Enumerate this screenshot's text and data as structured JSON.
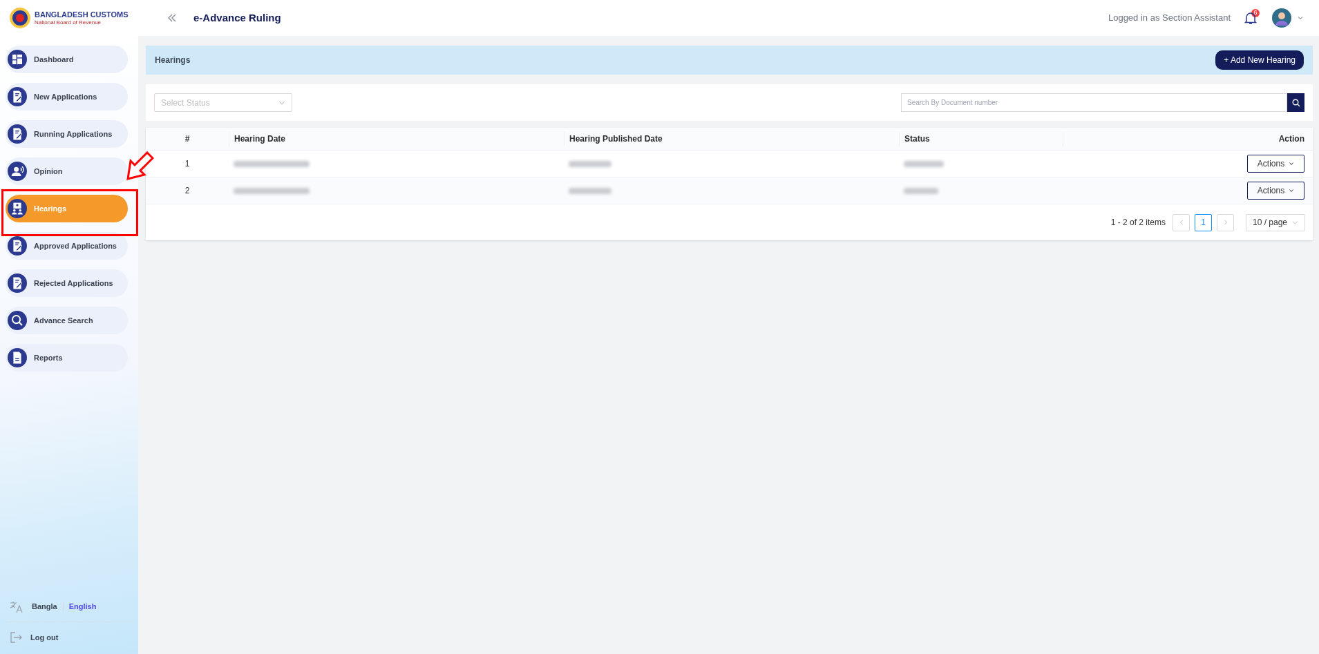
{
  "header": {
    "logo_title": "BANGLADESH CUSTOMS",
    "logo_subtitle": "National Board of Revenue",
    "app_title": "e-Advance Ruling",
    "user_label": "Logged in as Section Assistant",
    "notification_count": "6"
  },
  "sidebar": {
    "items": [
      {
        "label": "Dashboard",
        "kind": "dashboard",
        "selected": false
      },
      {
        "label": "New Applications",
        "kind": "document",
        "selected": false
      },
      {
        "label": "Running Applications",
        "kind": "document",
        "selected": false
      },
      {
        "label": "Opinion",
        "kind": "opinion",
        "selected": false
      },
      {
        "label": "Hearings",
        "kind": "hearing",
        "selected": true
      },
      {
        "label": "Approved Applications",
        "kind": "document",
        "selected": false
      },
      {
        "label": "Rejected Applications",
        "kind": "document",
        "selected": false
      },
      {
        "label": "Advance Search",
        "kind": "search",
        "selected": false
      },
      {
        "label": "Reports",
        "kind": "report",
        "selected": false
      }
    ],
    "languages": [
      {
        "label": "Bangla",
        "selected": false
      },
      {
        "label": "English",
        "selected": true
      }
    ],
    "logout": "Log out"
  },
  "page": {
    "title": "Hearings",
    "add_button": "+ Add New Hearing",
    "status_filter": {
      "placeholder": "Select Status"
    },
    "search": {
      "placeholder": "Search By Document number"
    }
  },
  "table": {
    "columns": [
      "#",
      "Hearing Date",
      "Hearing Published Date",
      "Status",
      "Action"
    ],
    "rows": [
      {
        "index": "1",
        "action": "Actions"
      },
      {
        "index": "2",
        "action": "Actions"
      }
    ]
  },
  "pagination": {
    "summary": "1 - 2 of 2 items",
    "pages": [
      {
        "label": "1",
        "selected": true
      }
    ],
    "page_size": "10 / page"
  }
}
